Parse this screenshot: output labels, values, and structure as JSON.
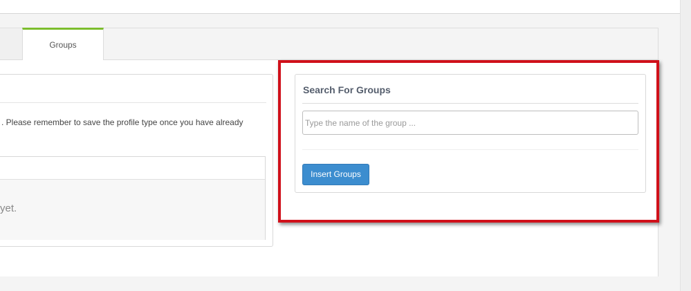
{
  "tabs": [
    {
      "label": "Groups",
      "active": true
    }
  ],
  "left_panel": {
    "description": ". Please remember to save the profile type once you have already",
    "empty_message": "yet."
  },
  "search_panel": {
    "title": "Search For Groups",
    "input_placeholder": "Type the name of the group ...",
    "input_value": "",
    "insert_button_label": "Insert Groups"
  },
  "colors": {
    "active_tab_accent": "#7cbd2d",
    "highlight_border": "#d0101a",
    "primary_button": "#3c8dcf"
  }
}
